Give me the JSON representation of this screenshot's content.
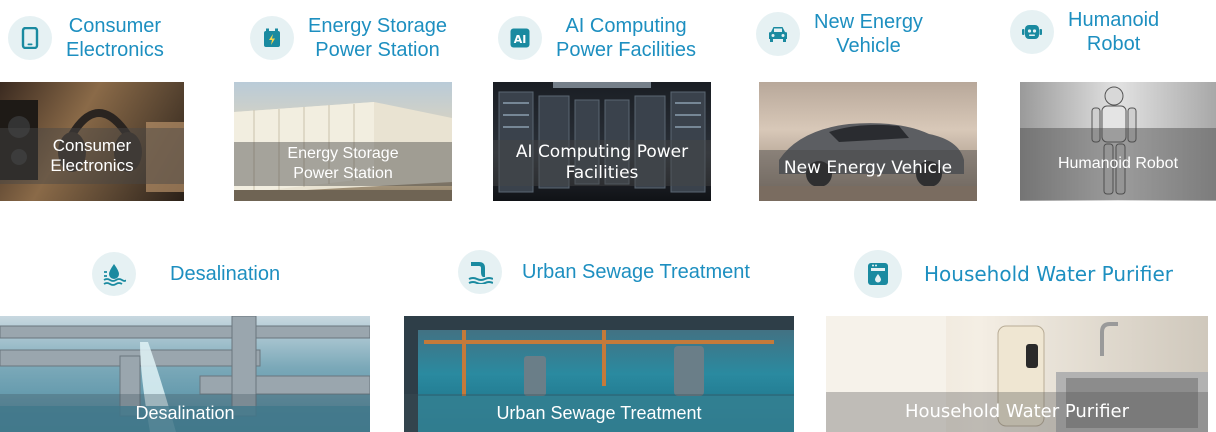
{
  "categories_row1": [
    {
      "label": "Consumer\nElectronics",
      "icon": "tablet-icon"
    },
    {
      "label": "Energy Storage\nPower Station",
      "icon": "battery-icon"
    },
    {
      "label": "AI Computing\nPower Facilities",
      "icon": "ai-chip-icon"
    },
    {
      "label": "New Energy\nVehicle",
      "icon": "car-icon"
    },
    {
      "label": "Humanoid\nRobot",
      "icon": "robot-icon"
    }
  ],
  "categories_row2": [
    {
      "label": "Desalination",
      "icon": "water-drop-waves-icon"
    },
    {
      "label": "Urban Sewage Treatment",
      "icon": "sewage-pipe-icon"
    },
    {
      "label": "Household Water Purifier",
      "icon": "water-purifier-icon"
    }
  ],
  "photos_row1": [
    {
      "caption": "Consumer\nElectronics",
      "alt": "headphones and speaker"
    },
    {
      "caption": "Energy Storage\nPower Station",
      "alt": "battery containers"
    },
    {
      "caption": "AI Computing Power\nFacilities",
      "alt": "server racks"
    },
    {
      "caption": "New Energy Vehicle",
      "alt": "electric car"
    },
    {
      "caption": "Humanoid Robot",
      "alt": "humanoid robot"
    }
  ],
  "photos_row2": [
    {
      "caption": "Desalination",
      "alt": "pipes with flowing water"
    },
    {
      "caption": "Urban Sewage Treatment",
      "alt": "treatment plant tanks"
    },
    {
      "caption": "Household Water Purifier",
      "alt": "kitchen water purifier"
    }
  ],
  "colors": {
    "accent": "#1d8fc0",
    "icon_bg": "#e6f1f3",
    "icon_fg": "#1a8aa0"
  }
}
